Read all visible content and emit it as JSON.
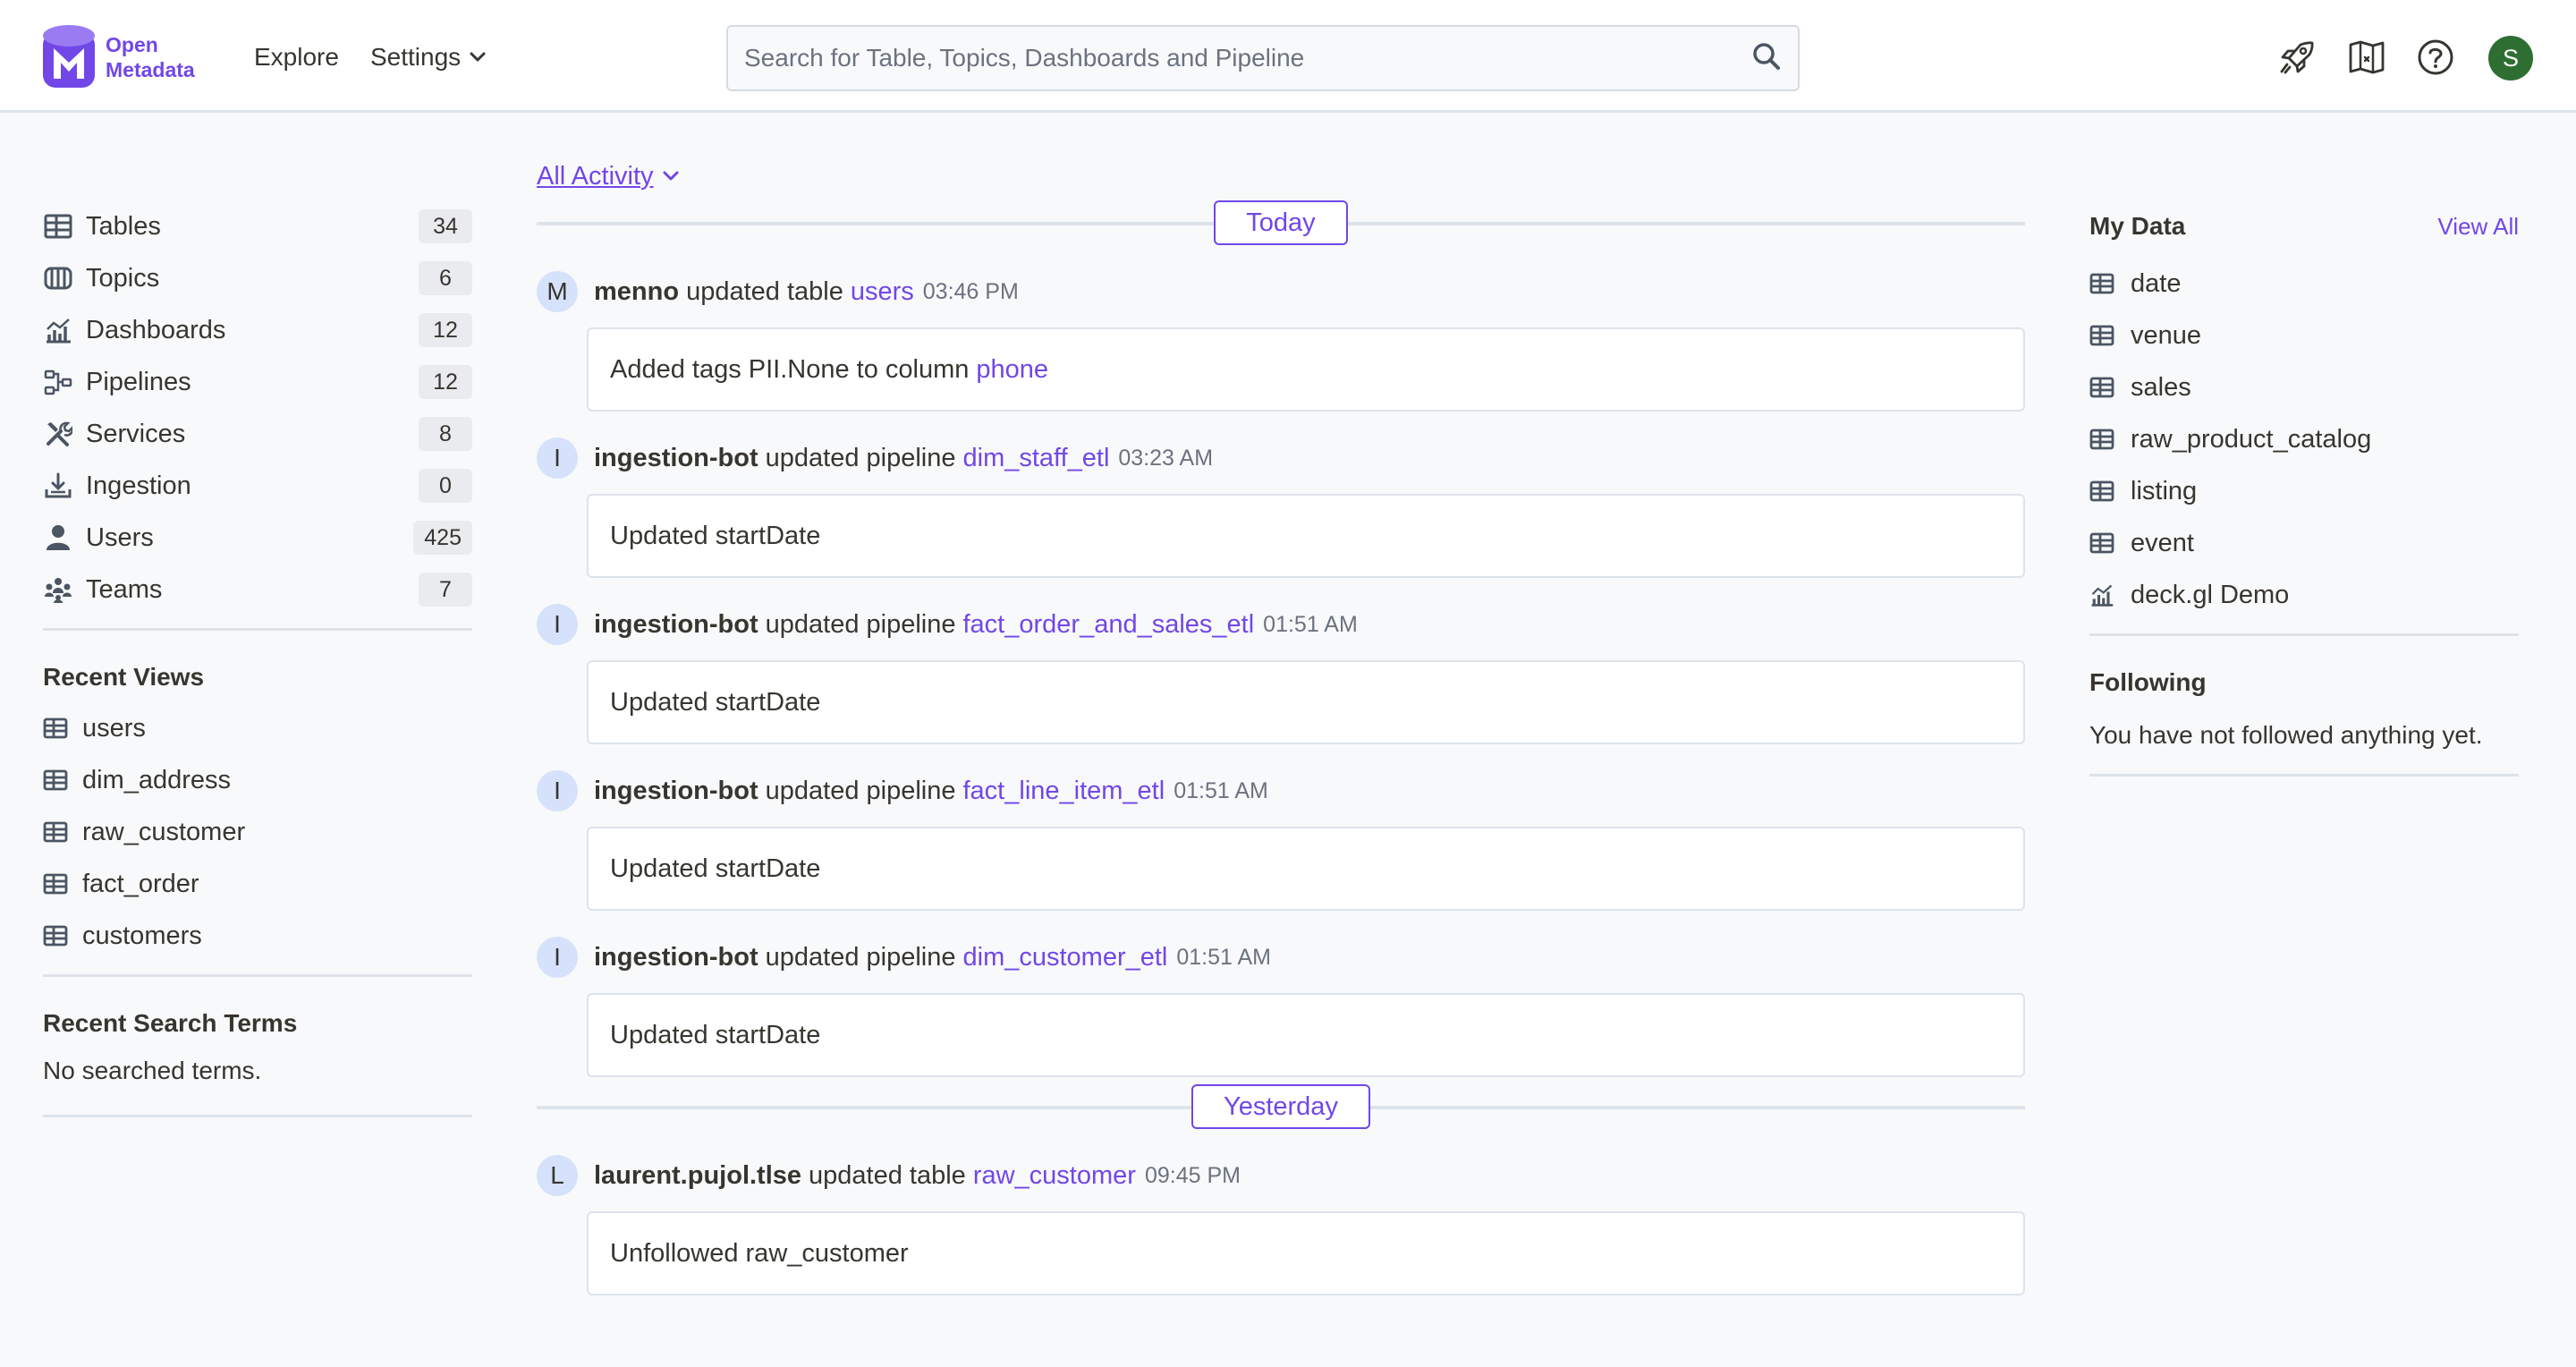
{
  "header": {
    "logo_line1": "Open",
    "logo_line2": "Metadata",
    "nav": {
      "explore": "Explore",
      "settings": "Settings"
    },
    "search_placeholder": "Search for Table, Topics, Dashboards and Pipeline",
    "user_initial": "S"
  },
  "sidebar": {
    "entities": [
      {
        "label": "Tables",
        "count": "34",
        "icon": "table-icon"
      },
      {
        "label": "Topics",
        "count": "6",
        "icon": "topic-icon"
      },
      {
        "label": "Dashboards",
        "count": "12",
        "icon": "dashboard-icon"
      },
      {
        "label": "Pipelines",
        "count": "12",
        "icon": "pipeline-icon"
      },
      {
        "label": "Services",
        "count": "8",
        "icon": "services-icon"
      },
      {
        "label": "Ingestion",
        "count": "0",
        "icon": "ingestion-icon"
      },
      {
        "label": "Users",
        "count": "425",
        "icon": "user-icon"
      },
      {
        "label": "Teams",
        "count": "7",
        "icon": "teams-icon"
      }
    ],
    "recent_views_title": "Recent Views",
    "recent_views": [
      "users",
      "dim_address",
      "raw_customer",
      "fact_order",
      "customers"
    ],
    "recent_search_title": "Recent Search Terms",
    "recent_search_empty": "No searched terms."
  },
  "feed": {
    "filter_label": "All Activity",
    "groups": [
      {
        "date": "Today",
        "items": [
          {
            "initial": "M",
            "user": "menno",
            "action": "updated table",
            "entity": "users",
            "time": "03:46 PM",
            "message": "Added tags PII.None to column",
            "message_link": "phone"
          },
          {
            "initial": "I",
            "user": "ingestion-bot",
            "action": "updated pipeline",
            "entity": "dim_staff_etl",
            "time": "03:23 AM",
            "message": "Updated startDate",
            "message_link": ""
          },
          {
            "initial": "I",
            "user": "ingestion-bot",
            "action": "updated pipeline",
            "entity": "fact_order_and_sales_etl",
            "time": "01:51 AM",
            "message": "Updated startDate",
            "message_link": ""
          },
          {
            "initial": "I",
            "user": "ingestion-bot",
            "action": "updated pipeline",
            "entity": "fact_line_item_etl",
            "time": "01:51 AM",
            "message": "Updated startDate",
            "message_link": ""
          },
          {
            "initial": "I",
            "user": "ingestion-bot",
            "action": "updated pipeline",
            "entity": "dim_customer_etl",
            "time": "01:51 AM",
            "message": "Updated startDate",
            "message_link": ""
          }
        ]
      },
      {
        "date": "Yesterday",
        "items": [
          {
            "initial": "L",
            "user": "laurent.pujol.tlse",
            "action": "updated table",
            "entity": "raw_customer",
            "time": "09:45 PM",
            "message": "Unfollowed raw_customer",
            "message_link": ""
          }
        ]
      }
    ]
  },
  "right_panel": {
    "my_data_title": "My Data",
    "view_all": "View All",
    "my_data": [
      {
        "label": "date",
        "icon": "table-icon"
      },
      {
        "label": "venue",
        "icon": "table-icon"
      },
      {
        "label": "sales",
        "icon": "table-icon"
      },
      {
        "label": "raw_product_catalog",
        "icon": "table-icon"
      },
      {
        "label": "listing",
        "icon": "table-icon"
      },
      {
        "label": "event",
        "icon": "table-icon"
      },
      {
        "label": "deck.gl Demo",
        "icon": "dashboard-icon"
      }
    ],
    "following_title": "Following",
    "following_empty": "You have not followed anything yet."
  },
  "colors": {
    "accent": "#7147e8",
    "text": "#37352f",
    "background": "#f8f9fa",
    "avatar_user": "#2f6e32"
  }
}
